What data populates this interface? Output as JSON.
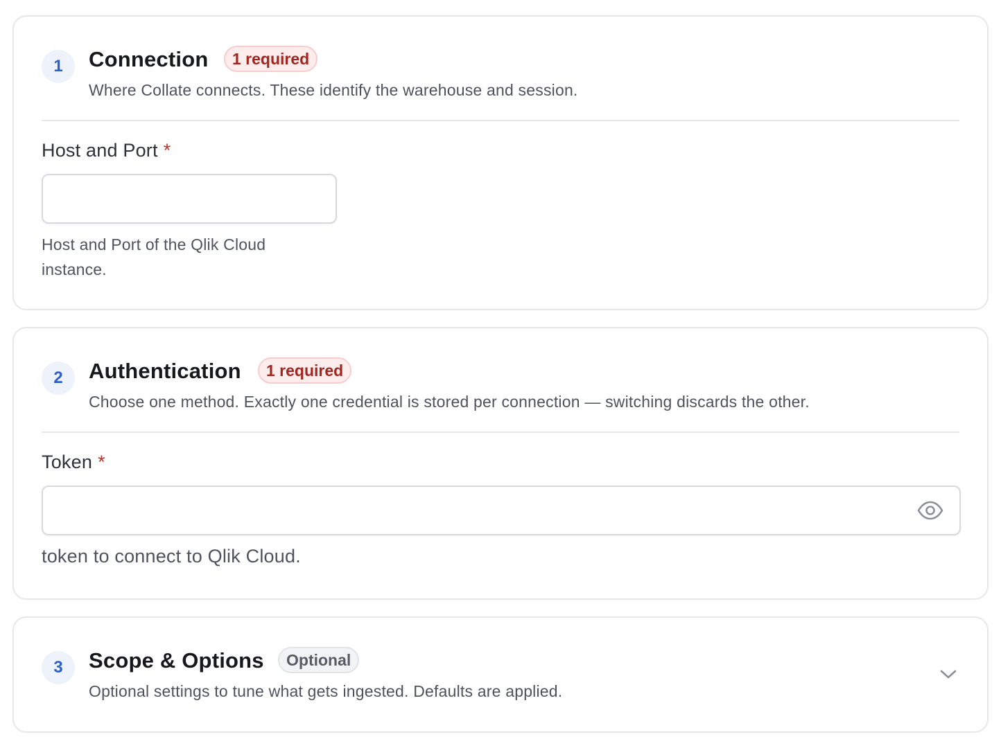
{
  "sections": [
    {
      "step": "1",
      "title": "Connection",
      "badge": "1 required",
      "description": "Where Collate connects. These identify the warehouse and session.",
      "field": {
        "label": "Host and Port",
        "required_mark": "*",
        "value": "",
        "help": "Host and Port of the Qlik Cloud instance."
      }
    },
    {
      "step": "2",
      "title": "Authentication",
      "badge": "1 required",
      "description": "Choose one method. Exactly one credential is stored per connection — switching discards the other.",
      "field": {
        "label": "Token",
        "required_mark": "*",
        "value": "",
        "help": "token to connect to Qlik Cloud.",
        "icon": "eye-icon"
      }
    },
    {
      "step": "3",
      "title": "Scope & Options",
      "badge": "Optional",
      "description": "Optional settings to tune what gets ingested. Defaults are applied.",
      "expand_icon": "chevron-down-icon"
    }
  ],
  "colors": {
    "accent": "#2f5fc4",
    "required_badge_bg": "#fdecec",
    "required_text": "#a1261f",
    "border": "#e6e7ea"
  }
}
